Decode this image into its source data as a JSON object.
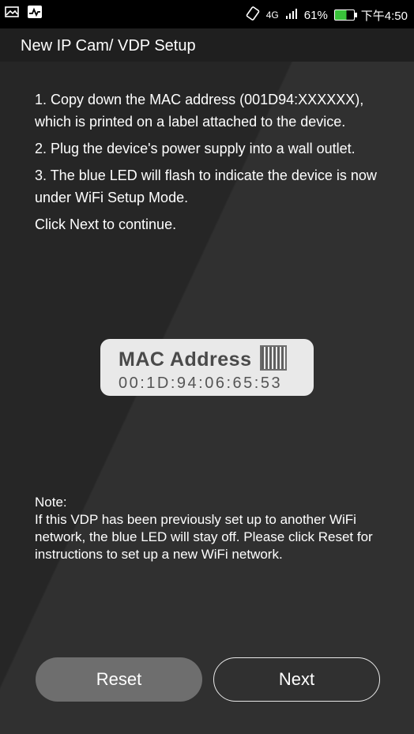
{
  "status_bar": {
    "left_icons": [
      "image-icon",
      "activity-icon"
    ],
    "network": "4G",
    "battery_percent": "61%",
    "time": "下午4:50"
  },
  "title": "New IP Cam/ VDP Setup",
  "steps": [
    "1. Copy down the MAC address (001D94:XXXXXX), which is printed on a label attached to the device.",
    "2. Plug the device's power supply into a wall outlet.",
    "3. The blue LED will flash to indicate the device is now under WiFi Setup Mode.",
    "Click Next to continue."
  ],
  "mac_badge": {
    "label": "MAC Address",
    "value": "00:1D:94:06:65:53"
  },
  "note": {
    "heading": "Note:",
    "body": "If this VDP has been previously set up to another WiFi network, the blue LED will stay off. Please click Reset for instructions to set up a new WiFi network."
  },
  "buttons": {
    "reset": "Reset",
    "next": "Next"
  },
  "colors": {
    "background": "#2b2b2b",
    "titlebar": "#1f1f1f",
    "reset_button": "#6e6e6e",
    "battery_fill": "#39c23a"
  }
}
